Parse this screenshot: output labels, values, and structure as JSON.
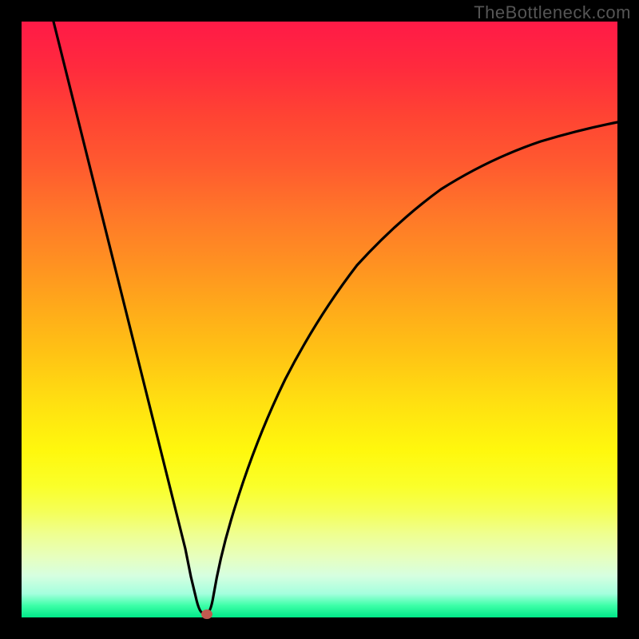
{
  "watermark": "TheBottleneck.com",
  "chart_data": {
    "type": "line",
    "title": "",
    "xlabel": "",
    "ylabel": "",
    "xlim": [
      0,
      100
    ],
    "ylim": [
      0,
      100
    ],
    "x": [
      0,
      5,
      10,
      15,
      20,
      23,
      26,
      28,
      29,
      30,
      31,
      33,
      36,
      40,
      45,
      50,
      55,
      60,
      65,
      70,
      75,
      80,
      85,
      90,
      95,
      100
    ],
    "values": [
      100,
      83,
      66,
      49,
      32,
      22,
      11,
      4,
      1,
      0,
      1,
      7,
      17,
      28,
      38,
      46,
      53,
      58,
      63,
      67,
      70,
      73,
      75.5,
      78,
      79.5,
      81
    ],
    "minimum_point": {
      "x": 30,
      "y": 0
    },
    "curve_description": "V-shaped bottleneck curve: steep linear descent from top-left to a sharp minimum around x≈30%, then a concave-down rise toward the upper right."
  },
  "colors": {
    "background": "#000000",
    "gradient_top": "#ff1a47",
    "gradient_bottom": "#00e888",
    "curve": "#000000",
    "dot": "#c15a50",
    "watermark": "#555555"
  }
}
